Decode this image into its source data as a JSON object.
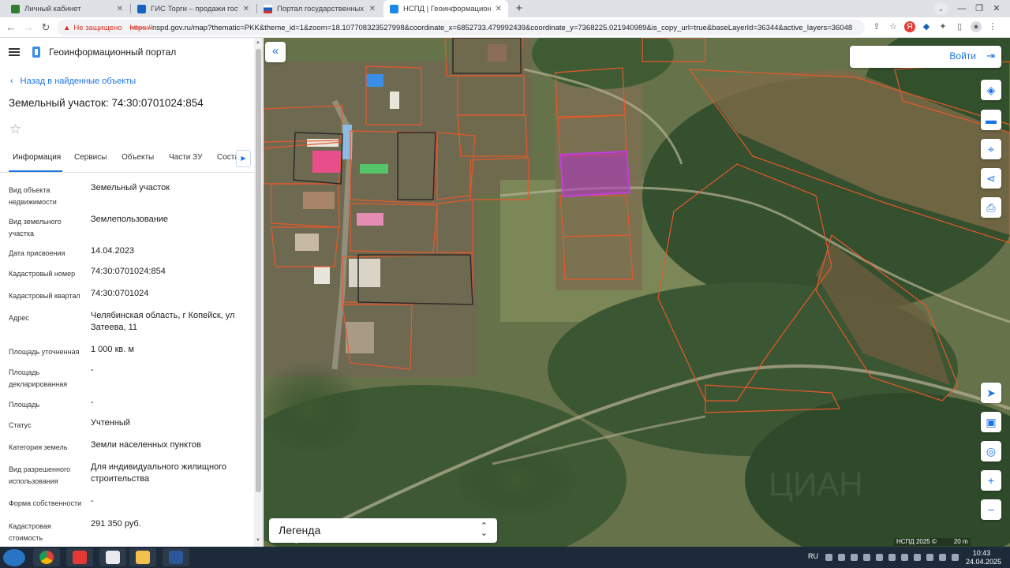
{
  "browser": {
    "tabs": [
      {
        "title": "Личный кабинет",
        "color": "#2e7d32"
      },
      {
        "title": "ГИС Торги – продажи государст",
        "color": "#1565c0"
      },
      {
        "title": "Портал государственных услуг",
        "color": "#d32f2f"
      },
      {
        "title": "НСПД | Геоинформационный п",
        "color": "#1e88e5"
      }
    ],
    "new_tab": "+",
    "security": "Не защищено",
    "url_proto": "https://",
    "url_rest": "nspd.gov.ru/map?thematic=PKK&theme_id=1&zoom=18.107708323527998&coordinate_x=6852733.479992439&coordinate_y=7368225.021940989&is_copy_url=true&baseLayerId=36344&active_layers=36048"
  },
  "panel": {
    "portal_title": "Геоинформационный портал",
    "back_label": "Назад в найденные объекты",
    "object_title": "Земельный участок: 74:30:0701024:854",
    "tabs": [
      "Информация",
      "Сервисы",
      "Объекты",
      "Части ЗУ",
      "Соста"
    ],
    "fields": [
      {
        "label": "Вид объекта недвижимости",
        "value": "Земельный участок"
      },
      {
        "label": "Вид земельного участка",
        "value": "Землепользование"
      },
      {
        "label": "Дата присвоения",
        "value": "14.04.2023"
      },
      {
        "label": "Кадастровый номер",
        "value": "74:30:0701024:854"
      },
      {
        "label": "Кадастровый квартал",
        "value": "74:30:0701024"
      },
      {
        "label": "Адрес",
        "value": "Челябинская область, г Копейск, ул Затеева, 11"
      },
      {
        "label": "Площадь уточненная",
        "value": "1 000 кв. м"
      },
      {
        "label": "Площадь декларированная",
        "value": "-"
      },
      {
        "label": "Площадь",
        "value": "-"
      },
      {
        "label": "Статус",
        "value": "Учтенный"
      },
      {
        "label": "Категория земель",
        "value": "Земли населенных пунктов"
      },
      {
        "label": "Вид разрешенного использования",
        "value": "Для индивидуального жилищного строительства"
      },
      {
        "label": "Форма собственности",
        "value": "-"
      },
      {
        "label": "Кадастровая стоимость",
        "value": "291 350 руб."
      }
    ]
  },
  "map": {
    "login_label": "Войти",
    "legend_label": "Легенда",
    "scale_copyright": "НСПД 2025 ©",
    "scale_distance": "20 m",
    "parcel_color": "#e8582a",
    "selected_color": "#b531c8"
  },
  "taskbar": {
    "lang": "RU",
    "time": "10:43",
    "date": "24.04.2025"
  }
}
